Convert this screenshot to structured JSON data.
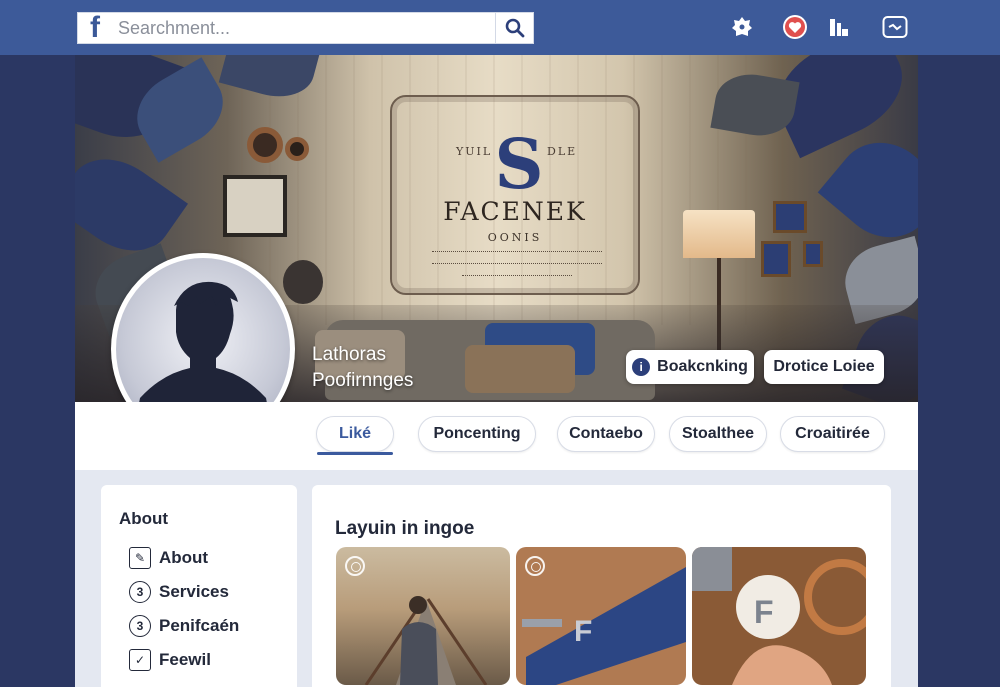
{
  "search": {
    "logo_letter": "f",
    "placeholder": "Searchment..."
  },
  "top_icons": [
    "notifications-icon",
    "heart-icon",
    "buildings-icon",
    "messenger-icon"
  ],
  "cover": {
    "sign_mark": "S",
    "sign_left": "YUIL",
    "sign_right": "DLE",
    "sign_title": "FACENEK",
    "sign_subtitle": "OONIS",
    "page_name_line1": "Lathoras",
    "page_name_line2": "Poofirnnges",
    "booking_button": "Boakcnking",
    "booking_icon": "i",
    "secondary_button": "Drotice Loiee"
  },
  "tabs": [
    {
      "label": "Liké",
      "active": true
    },
    {
      "label": "Poncenting",
      "active": false
    },
    {
      "label": "Contaebo",
      "active": false
    },
    {
      "label": "Stoalthee",
      "active": false
    },
    {
      "label": "Croaitirée",
      "active": false
    }
  ],
  "about": {
    "title": "About",
    "items": [
      {
        "label": "About",
        "icon": "edit-icon",
        "glyph": "✎"
      },
      {
        "label": "Services",
        "icon": "services-icon",
        "glyph": "3"
      },
      {
        "label": "Penifcaén",
        "icon": "permissions-icon",
        "glyph": "3"
      },
      {
        "label": "Feewil",
        "icon": "feedback-icon",
        "glyph": "✓"
      }
    ]
  },
  "content": {
    "title": "Layuin in ingoe"
  },
  "colors": {
    "topbar": "#3d5a99",
    "page_bg": "#2b3763",
    "accent": "#3b5a9e",
    "card": "#ffffff"
  }
}
